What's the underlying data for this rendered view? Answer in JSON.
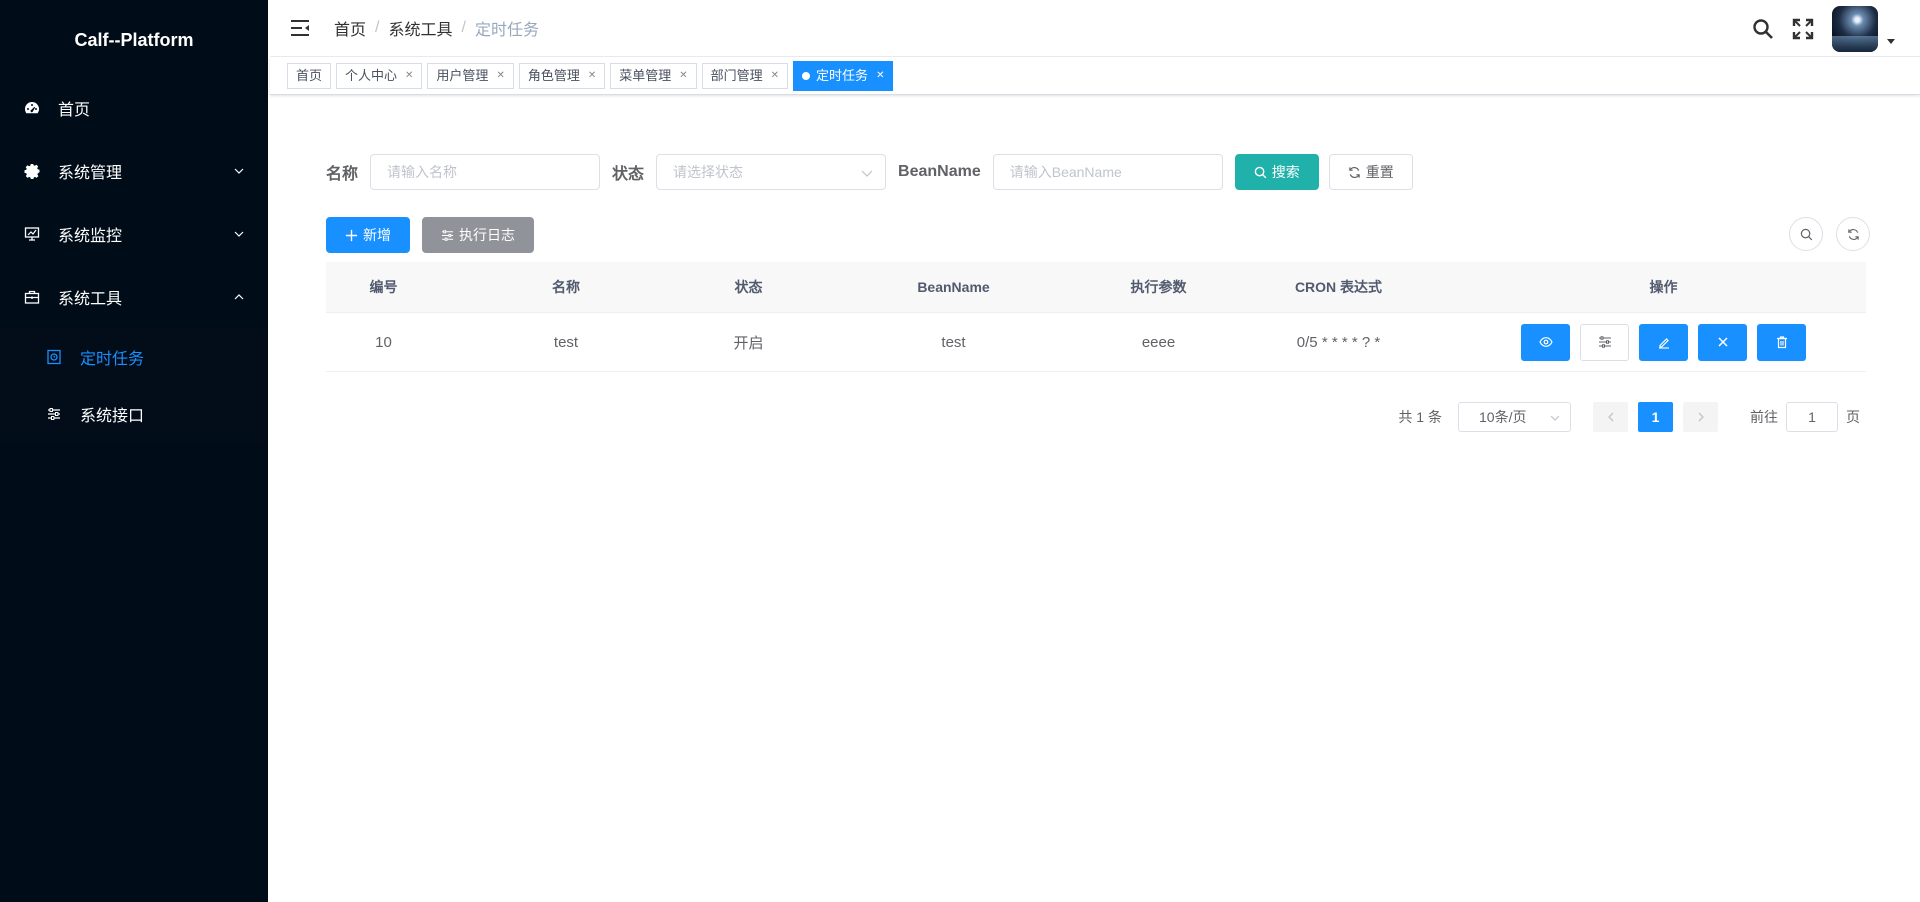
{
  "app": {
    "title": "Calf--Platform"
  },
  "sidebar": {
    "items": [
      {
        "label": "首页",
        "icon": "dashboard-icon"
      },
      {
        "label": "系统管理",
        "icon": "gear-icon",
        "expanded": false
      },
      {
        "label": "系统监控",
        "icon": "monitor-icon",
        "expanded": false
      },
      {
        "label": "系统工具",
        "icon": "toolbox-icon",
        "expanded": true,
        "children": [
          {
            "label": "定时任务",
            "icon": "job-icon",
            "active": true
          },
          {
            "label": "系统接口",
            "icon": "sliders-icon"
          }
        ]
      }
    ],
    "active_color": "#1890ff"
  },
  "header": {
    "breadcrumb": [
      "首页",
      "系统工具",
      "定时任务"
    ]
  },
  "tags": [
    {
      "label": "首页",
      "closable": false
    },
    {
      "label": "个人中心",
      "closable": true
    },
    {
      "label": "用户管理",
      "closable": true
    },
    {
      "label": "角色管理",
      "closable": true
    },
    {
      "label": "菜单管理",
      "closable": true
    },
    {
      "label": "部门管理",
      "closable": true
    },
    {
      "label": "定时任务",
      "closable": true,
      "active": true
    }
  ],
  "search": {
    "name_label": "名称",
    "name_placeholder": "请输入名称",
    "status_label": "状态",
    "status_placeholder": "请选择状态",
    "bean_label": "BeanName",
    "bean_placeholder": "请输入BeanName",
    "search_button": "搜索",
    "reset_button": "重置"
  },
  "toolbar": {
    "add_button": "新增",
    "log_button": "执行日志"
  },
  "table": {
    "columns": [
      "编号",
      "名称",
      "状态",
      "BeanName",
      "执行参数",
      "CRON 表达式",
      "操作"
    ],
    "rows": [
      {
        "id": "10",
        "name": "test",
        "status": "开启",
        "bean": "test",
        "params": "eeee",
        "cron": "0/5 * * * * ? *"
      }
    ]
  },
  "pagination": {
    "total": "共 1 条",
    "page_size": "10条/页",
    "current_page": "1",
    "goto_prefix": "前往",
    "goto_value": "1",
    "goto_suffix": "页"
  },
  "colors": {
    "primary": "#1890ff",
    "teal": "#20b2aa",
    "sidebar_bg": "#000c17"
  }
}
